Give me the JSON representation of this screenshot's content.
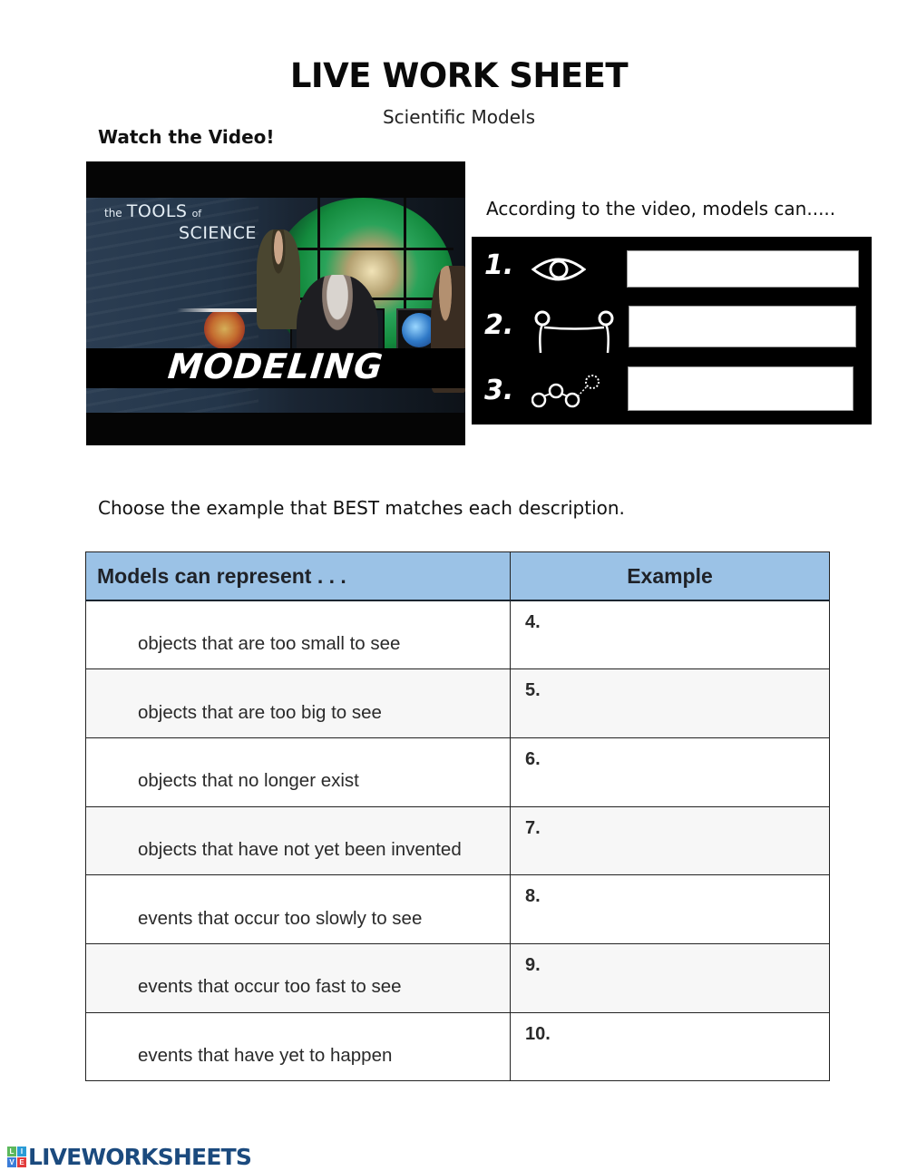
{
  "header": {
    "title": "LIVE WORK SHEET",
    "subtitle": "Scientific Models"
  },
  "video": {
    "prompt": "Watch the Video!",
    "thumbnail": {
      "series_the": "the",
      "series_tools": "TOOLS",
      "series_of": "of",
      "series_science": "SCIENCE",
      "episode": "MODELING"
    }
  },
  "models_can": {
    "prompt": "According to the video, models can.....",
    "items": [
      {
        "number": "1.",
        "icon": "eye-icon",
        "answer": ""
      },
      {
        "number": "2.",
        "icon": "bridge-connection-icon",
        "answer": ""
      },
      {
        "number": "3.",
        "icon": "prediction-chain-icon",
        "answer": ""
      }
    ]
  },
  "matching": {
    "instruction": "Choose the example that BEST matches each description.",
    "columns": [
      "Models can represent . . .",
      "Example"
    ],
    "rows": [
      {
        "description": "objects that are too small to see",
        "number": "4.",
        "answer": ""
      },
      {
        "description": "objects that are too big to see",
        "number": "5.",
        "answer": ""
      },
      {
        "description": "objects that no longer exist",
        "number": "6.",
        "answer": ""
      },
      {
        "description": "objects that have not yet been invented",
        "number": "7.",
        "answer": ""
      },
      {
        "description": "events that occur too slowly to see",
        "number": "8.",
        "answer": ""
      },
      {
        "description": "events that occur too fast to see",
        "number": "9.",
        "answer": ""
      },
      {
        "description": "events that have yet to happen",
        "number": "10.",
        "answer": ""
      }
    ],
    "header_color": "#9bc2e6"
  },
  "footer": {
    "logo_tiles": [
      "L",
      "I",
      "V",
      "E"
    ],
    "logo_tile_colors": [
      "#5cb85c",
      "#2a9bd6",
      "#3b7dd8",
      "#e23b3b"
    ],
    "logo_text": "LIVEWORKSHEETS"
  }
}
